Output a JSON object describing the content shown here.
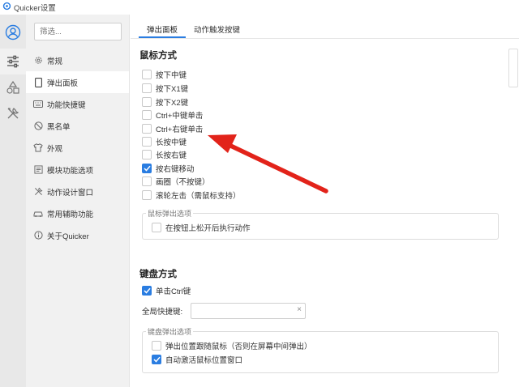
{
  "window": {
    "title": "Quicker设置"
  },
  "sidebar": {
    "filter_placeholder": "筛选...",
    "items": [
      {
        "label": "常规",
        "icon": "gear-icon"
      },
      {
        "label": "弹出面板",
        "icon": "panel-icon",
        "active": true
      },
      {
        "label": "功能快捷键",
        "icon": "keyboard-icon"
      },
      {
        "label": "黑名单",
        "icon": "block-icon"
      },
      {
        "label": "外观",
        "icon": "shirt-icon"
      },
      {
        "label": "模块功能选项",
        "icon": "module-icon"
      },
      {
        "label": "动作设计窗口",
        "icon": "tools-icon"
      },
      {
        "label": "常用辅助功能",
        "icon": "car-icon"
      },
      {
        "label": "关于Quicker",
        "icon": "info-icon"
      }
    ]
  },
  "tabs": [
    {
      "label": "弹出面板",
      "active": true
    },
    {
      "label": "动作触发按键",
      "active": false
    }
  ],
  "mouse": {
    "title": "鼠标方式",
    "options": [
      {
        "label": "按下中键",
        "checked": false
      },
      {
        "label": "按下X1键",
        "checked": false
      },
      {
        "label": "按下X2键",
        "checked": false
      },
      {
        "label": "Ctrl+中键单击",
        "checked": false
      },
      {
        "label": "Ctrl+右键单击",
        "checked": false
      },
      {
        "label": "长按中键",
        "checked": false
      },
      {
        "label": "长按右键",
        "checked": false
      },
      {
        "label": "按右键移动",
        "checked": true
      },
      {
        "label": "画圈（不按键）",
        "checked": false
      },
      {
        "label": "滚轮左击（需鼠标支持）",
        "checked": false
      }
    ],
    "group_label": "鼠标弹出选项",
    "group_options": [
      {
        "label": "在按钮上松开后执行动作",
        "checked": false
      }
    ]
  },
  "keyboard": {
    "title": "键盘方式",
    "single_ctrl": {
      "label": "单击Ctrl键",
      "checked": true
    },
    "hotkey_label": "全局快捷键:",
    "hotkey_value": "",
    "hotkey_clear": "×",
    "group_label": "键盘弹出选项",
    "group_options": [
      {
        "label": "弹出位置跟随鼠标（否则在屏幕中间弹出）",
        "checked": false
      },
      {
        "label": "自动激活鼠标位置窗口",
        "checked": true
      }
    ]
  },
  "colors": {
    "accent": "#2a7de1",
    "annotation_arrow": "#e2231a"
  }
}
